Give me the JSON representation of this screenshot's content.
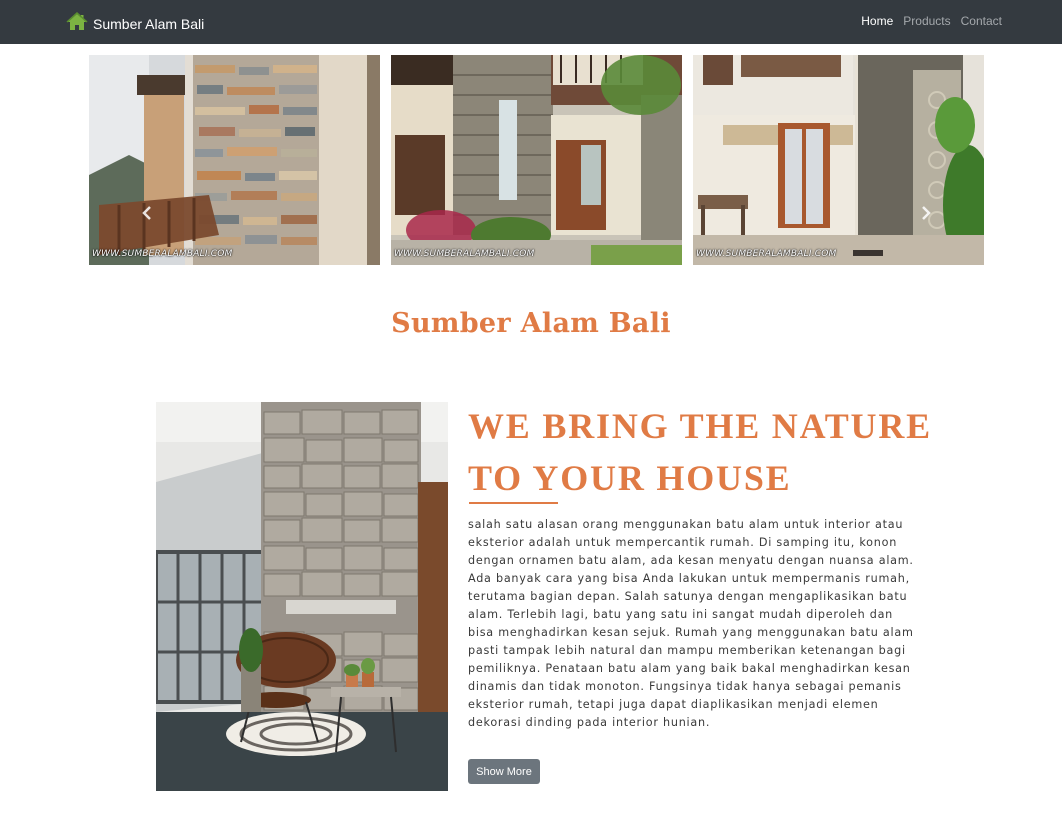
{
  "brand": {
    "name": "Sumber Alam Bali",
    "icon": "house-icon"
  },
  "nav": [
    {
      "label": "Home",
      "active": true
    },
    {
      "label": "Products",
      "active": false
    },
    {
      "label": "Contact",
      "active": false
    }
  ],
  "carousel": {
    "slides": [
      {
        "watermark": "WWW.SUMBERALAMBALI.COM"
      },
      {
        "watermark": "WWW.SUMBERALAMBALI.COM"
      },
      {
        "watermark": "WWW.SUMBERALAMBALI.COM"
      }
    ],
    "prev_icon": "chevron-left-icon",
    "next_icon": "chevron-right-icon"
  },
  "section_title": "Sumber Alam Bali",
  "feature": {
    "heading_line1": "WE BRING THE NATURE",
    "heading_line2": "TO YOUR HOUSE",
    "body": "salah satu alasan orang menggunakan batu alam untuk interior atau eksterior adalah untuk mempercantik rumah. Di samping itu, konon dengan ornamen batu alam, ada kesan menyatu dengan nuansa alam. Ada banyak cara yang bisa Anda lakukan untuk mempermanis rumah, terutama bagian depan. Salah satunya dengan mengaplikasikan batu alam. Terlebih lagi, batu yang satu ini sangat mudah diperoleh dan bisa menghadirkan kesan sejuk. Rumah yang menggunakan batu alam pasti tampak lebih natural dan mampu memberikan ketenangan bagi pemiliknya. Penataan batu alam yang baik bakal menghadirkan kesan dinamis dan tidak monoton. Fungsinya tidak hanya sebagai pemanis eksterior rumah, tetapi juga dapat diaplikasikan menjadi elemen dekorasi dinding pada interior hunian.",
    "button_label": "Show More"
  },
  "colors": {
    "accent": "#e07b45",
    "navbar": "#343a40",
    "button": "#6c757d"
  }
}
